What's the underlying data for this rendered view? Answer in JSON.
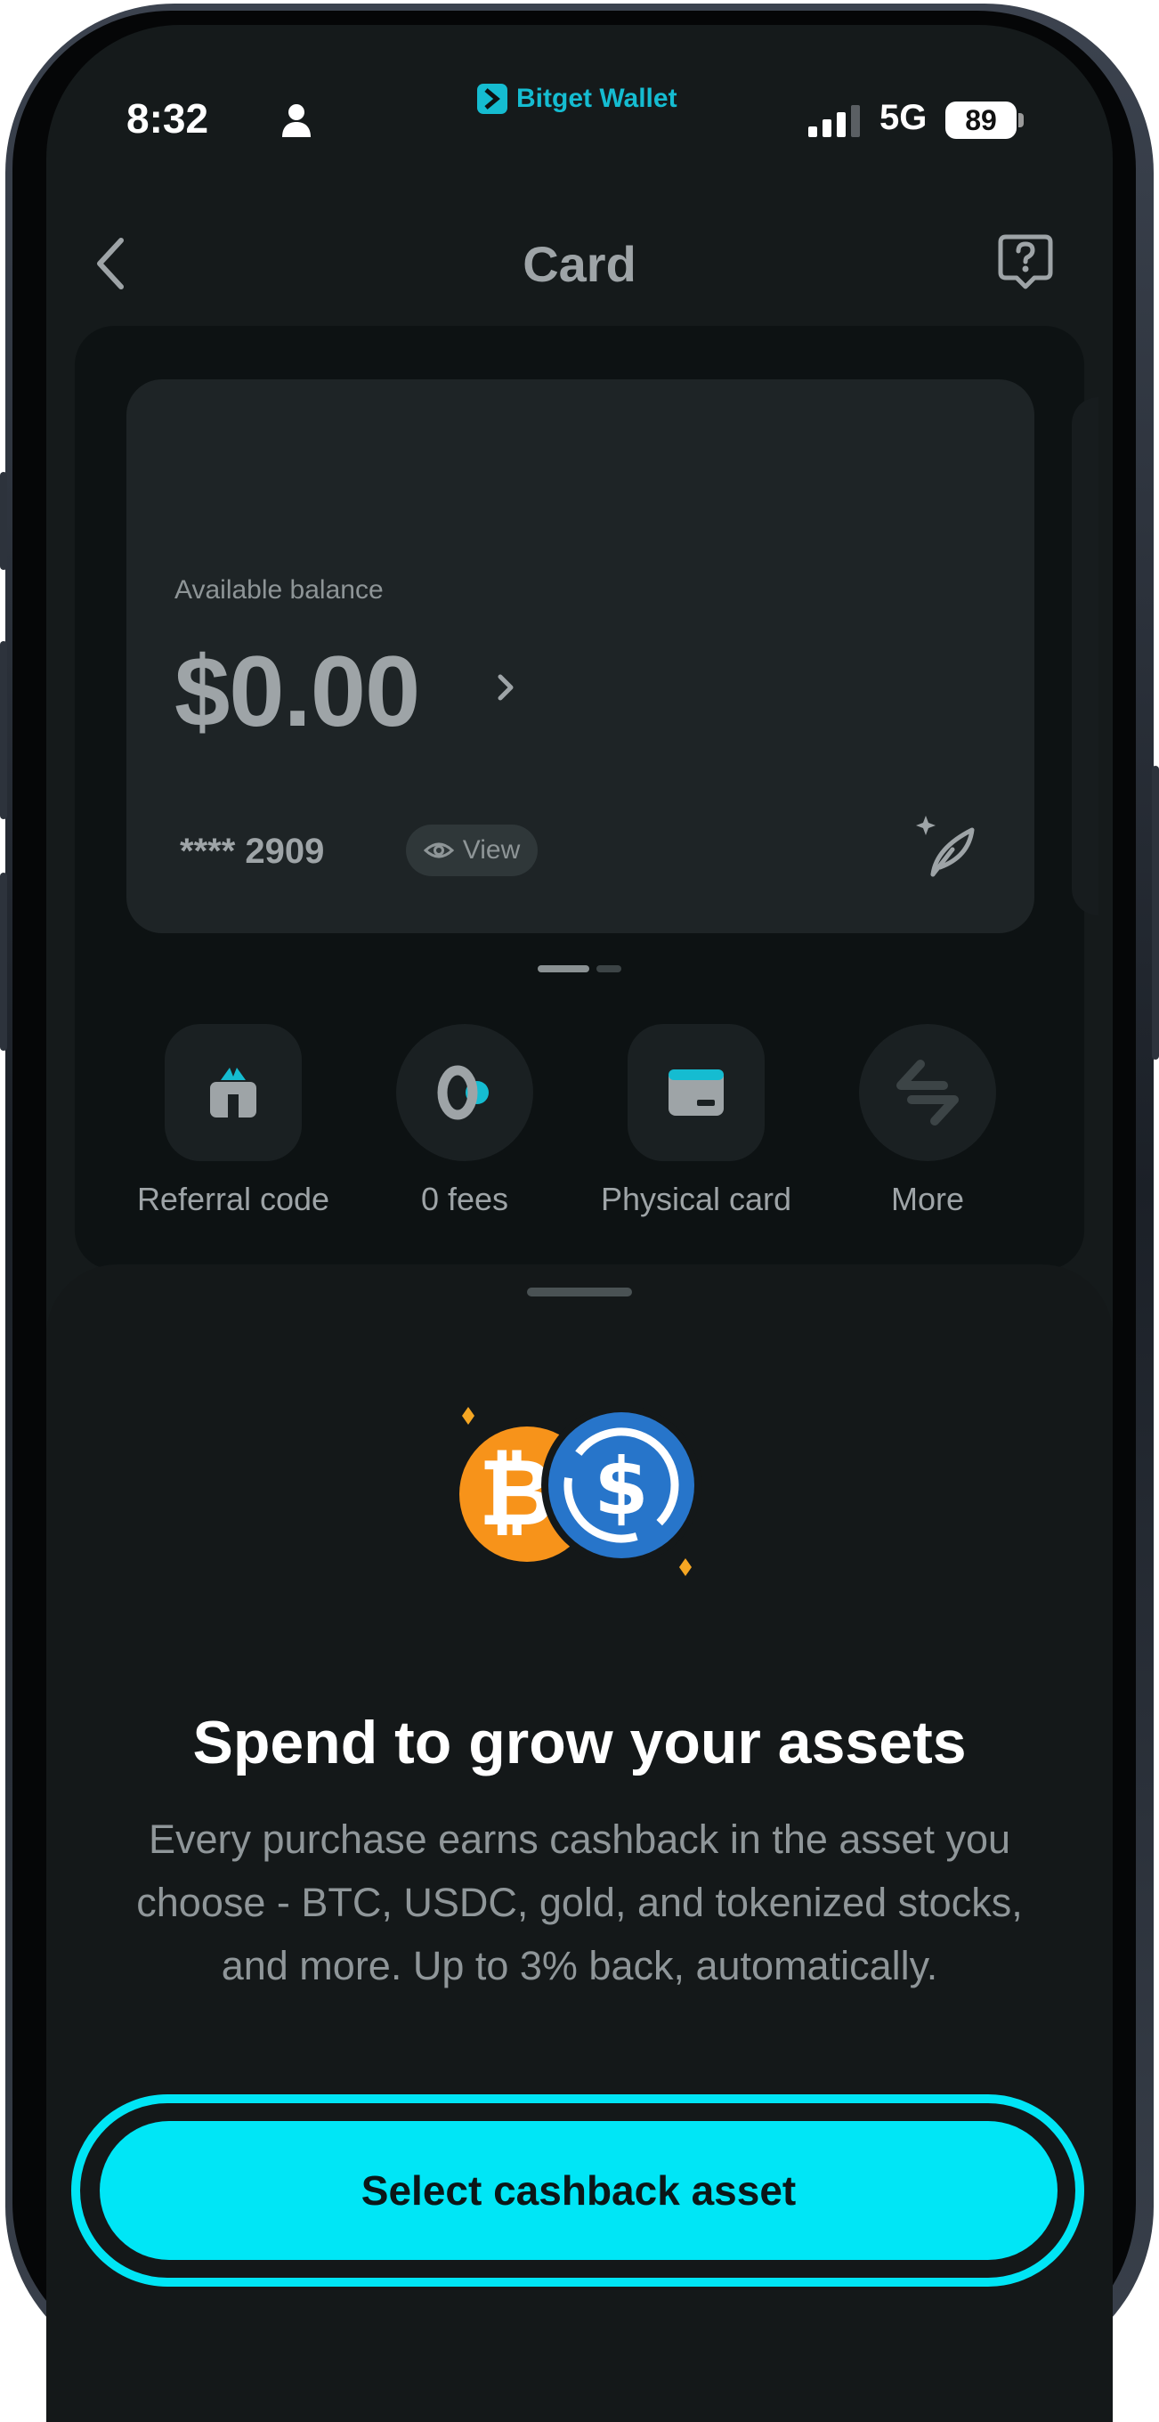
{
  "status_bar": {
    "time": "8:32",
    "brand_name": "Bitget Wallet",
    "network": "5G",
    "battery": "89"
  },
  "header": {
    "title": "Card"
  },
  "card": {
    "balance_label": "Available balance",
    "balance_amount": "$0.00",
    "card_number": "**** 2909",
    "view_label": "View"
  },
  "carousel": {
    "pages": 2,
    "active_page": 1
  },
  "actions": [
    {
      "label": "Referral code",
      "icon": "gift-icon"
    },
    {
      "label": "0 fees",
      "icon": "zero-fees-icon"
    },
    {
      "label": "Physical card",
      "icon": "physical-card-icon"
    },
    {
      "label": "More",
      "icon": "more-arrows-icon"
    }
  ],
  "sheet": {
    "title": "Spend to grow your assets",
    "body": "Every purchase earns cashback in the asset you choose - BTC, USDC, gold, and tokenized stocks, and more. Up to 3% back, automatically.",
    "cta_label": "Select cashback asset"
  },
  "colors": {
    "accent": "#00e6f6",
    "brand": "#15bcd1",
    "bitcoin": "#f7931a",
    "usdc": "#2775ca",
    "background": "#151a1b"
  }
}
